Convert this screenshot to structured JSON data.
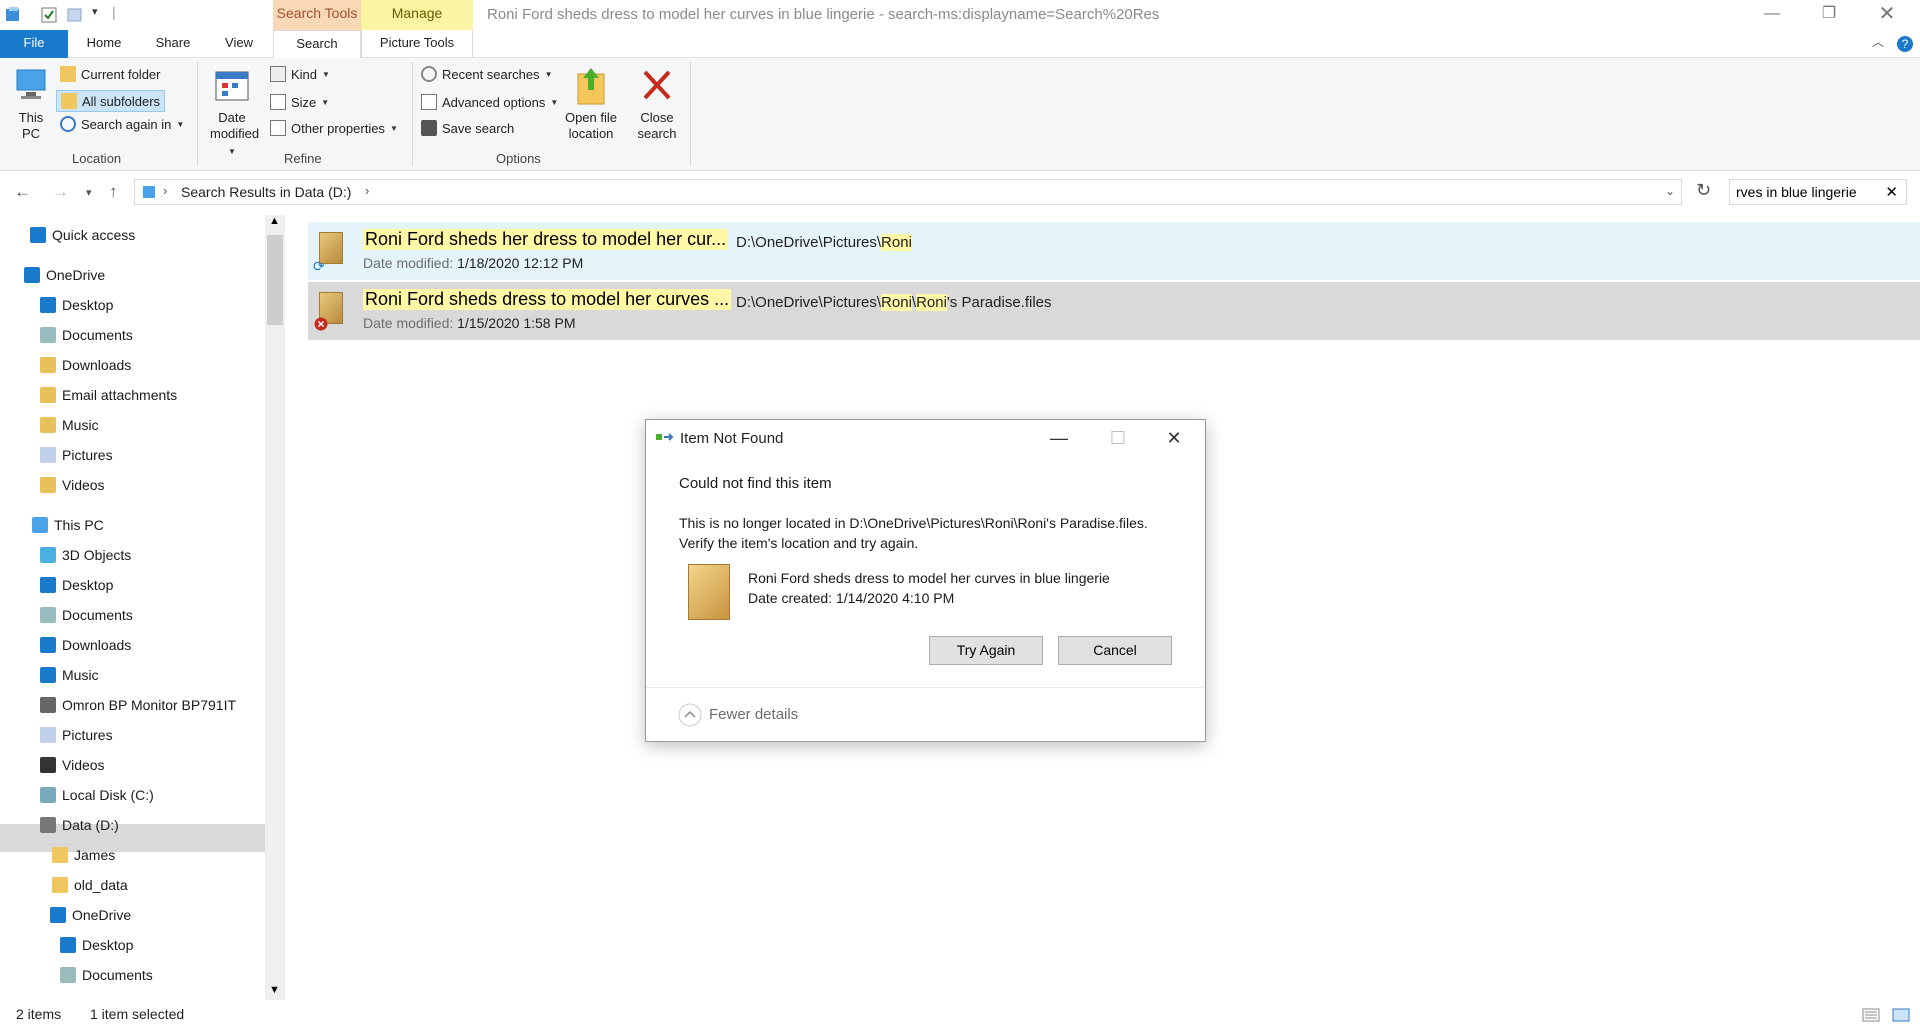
{
  "window": {
    "title": "Roni Ford sheds dress to model her curves in blue lingerie - search-ms:displayname=Search%20Res",
    "context_tabs": {
      "search_tools": "Search Tools",
      "manage": "Manage"
    },
    "qa_separator": "|"
  },
  "tabs": {
    "file": "File",
    "home": "Home",
    "share": "Share",
    "view": "View",
    "search": "Search",
    "picture_tools": "Picture Tools"
  },
  "ribbon": {
    "location": {
      "this_pc_line1": "This",
      "this_pc_line2": "PC",
      "current_folder": "Current folder",
      "all_subfolders": "All subfolders",
      "search_again_in": "Search again in",
      "label": "Location"
    },
    "refine": {
      "date_line1": "Date",
      "date_line2": "modified",
      "kind": "Kind",
      "size": "Size",
      "other_properties": "Other properties",
      "label": "Refine"
    },
    "options": {
      "recent_searches": "Recent searches",
      "advanced_options": "Advanced options",
      "save_search": "Save search",
      "open_line1": "Open file",
      "open_line2": "location",
      "close_line1": "Close",
      "close_line2": "search",
      "label": "Options"
    }
  },
  "address": {
    "breadcrumb": "Search Results in Data (D:)",
    "search_value": "rves in blue lingerie"
  },
  "navpane": {
    "items": [
      {
        "label": "Quick access"
      },
      {
        "label": "OneDrive"
      },
      {
        "label": "Desktop"
      },
      {
        "label": "Documents"
      },
      {
        "label": "Downloads"
      },
      {
        "label": "Email attachments"
      },
      {
        "label": "Music"
      },
      {
        "label": "Pictures"
      },
      {
        "label": "Videos"
      },
      {
        "label": "This PC"
      },
      {
        "label": "3D Objects"
      },
      {
        "label": "Desktop"
      },
      {
        "label": "Documents"
      },
      {
        "label": "Downloads"
      },
      {
        "label": "Music"
      },
      {
        "label": "Omron BP Monitor BP791IT"
      },
      {
        "label": "Pictures"
      },
      {
        "label": "Videos"
      },
      {
        "label": "Local Disk (C:)"
      },
      {
        "label": "Data (D:)"
      },
      {
        "label": "James"
      },
      {
        "label": "old_data"
      },
      {
        "label": "OneDrive"
      },
      {
        "label": "Desktop"
      },
      {
        "label": "Documents"
      }
    ]
  },
  "results": [
    {
      "name": "Roni Ford sheds her dress to model her cur...",
      "date_label": "Date modified:",
      "date": "1/18/2020 12:12 PM",
      "path_prefix": "D:\\OneDrive\\Pictures\\",
      "path_hl1": "Roni",
      "path_mid": "",
      "path_hl2": "",
      "path_suffix": ""
    },
    {
      "name": "Roni Ford sheds dress to model her curves ...",
      "date_label": "Date modified:",
      "date": "1/15/2020 1:58 PM",
      "path_prefix": "D:\\OneDrive\\Pictures\\",
      "path_hl1": "Roni",
      "path_mid": "\\",
      "path_hl2": "Roni",
      "path_suffix": "'s Paradise.files"
    }
  ],
  "dialog": {
    "title": "Item Not Found",
    "heading": "Could not find this item",
    "line1": "This is no longer located in D:\\OneDrive\\Pictures\\Roni\\Roni's Paradise.files.",
    "line2": "Verify the item's location and try again.",
    "item_name": "Roni Ford sheds dress to model her curves in blue lingerie",
    "item_date": "Date created: 1/14/2020 4:10 PM",
    "try_again": "Try Again",
    "cancel": "Cancel",
    "fewer_details": "Fewer details"
  },
  "status": {
    "count": "2 items",
    "selected": "1 item selected"
  },
  "colors": {
    "accent": "#1979ca",
    "highlight": "#fdf7a6",
    "selected_row": "#d9d9d9",
    "hover_row": "#e5f3fb"
  }
}
